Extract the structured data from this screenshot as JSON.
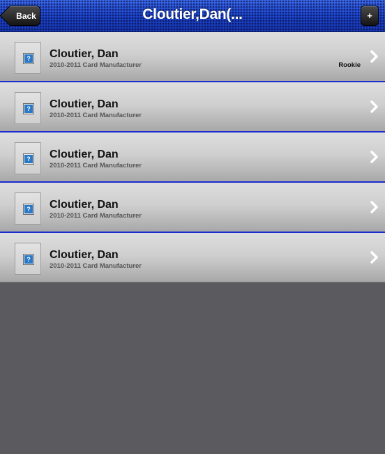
{
  "navbar": {
    "title": "Cloutier,Dan(...",
    "back_label": "Back",
    "add_label": "+"
  },
  "cards": [
    {
      "name": "Cloutier, Dan",
      "subtitle": "2010-2011 Card Manufacturer",
      "badge": "Rookie",
      "thumb_icon": "?"
    },
    {
      "name": "Cloutier, Dan",
      "subtitle": "2010-2011 Card Manufacturer",
      "badge": "",
      "thumb_icon": "?"
    },
    {
      "name": "Cloutier, Dan",
      "subtitle": "2010-2011 Card Manufacturer",
      "badge": "",
      "thumb_icon": "?"
    },
    {
      "name": "Cloutier, Dan",
      "subtitle": "2010-2011 Card Manufacturer",
      "badge": "",
      "thumb_icon": "?"
    },
    {
      "name": "Cloutier, Dan",
      "subtitle": "2010-2011 Card Manufacturer",
      "badge": "",
      "thumb_icon": "?"
    }
  ],
  "icons": {
    "thumbnail": "question-mark-icon",
    "disclosure": "chevron-right-icon"
  },
  "colors": {
    "navbar": "#1f48d0",
    "row_separator": "#1b2bd0",
    "background": "#5b5b5f"
  }
}
